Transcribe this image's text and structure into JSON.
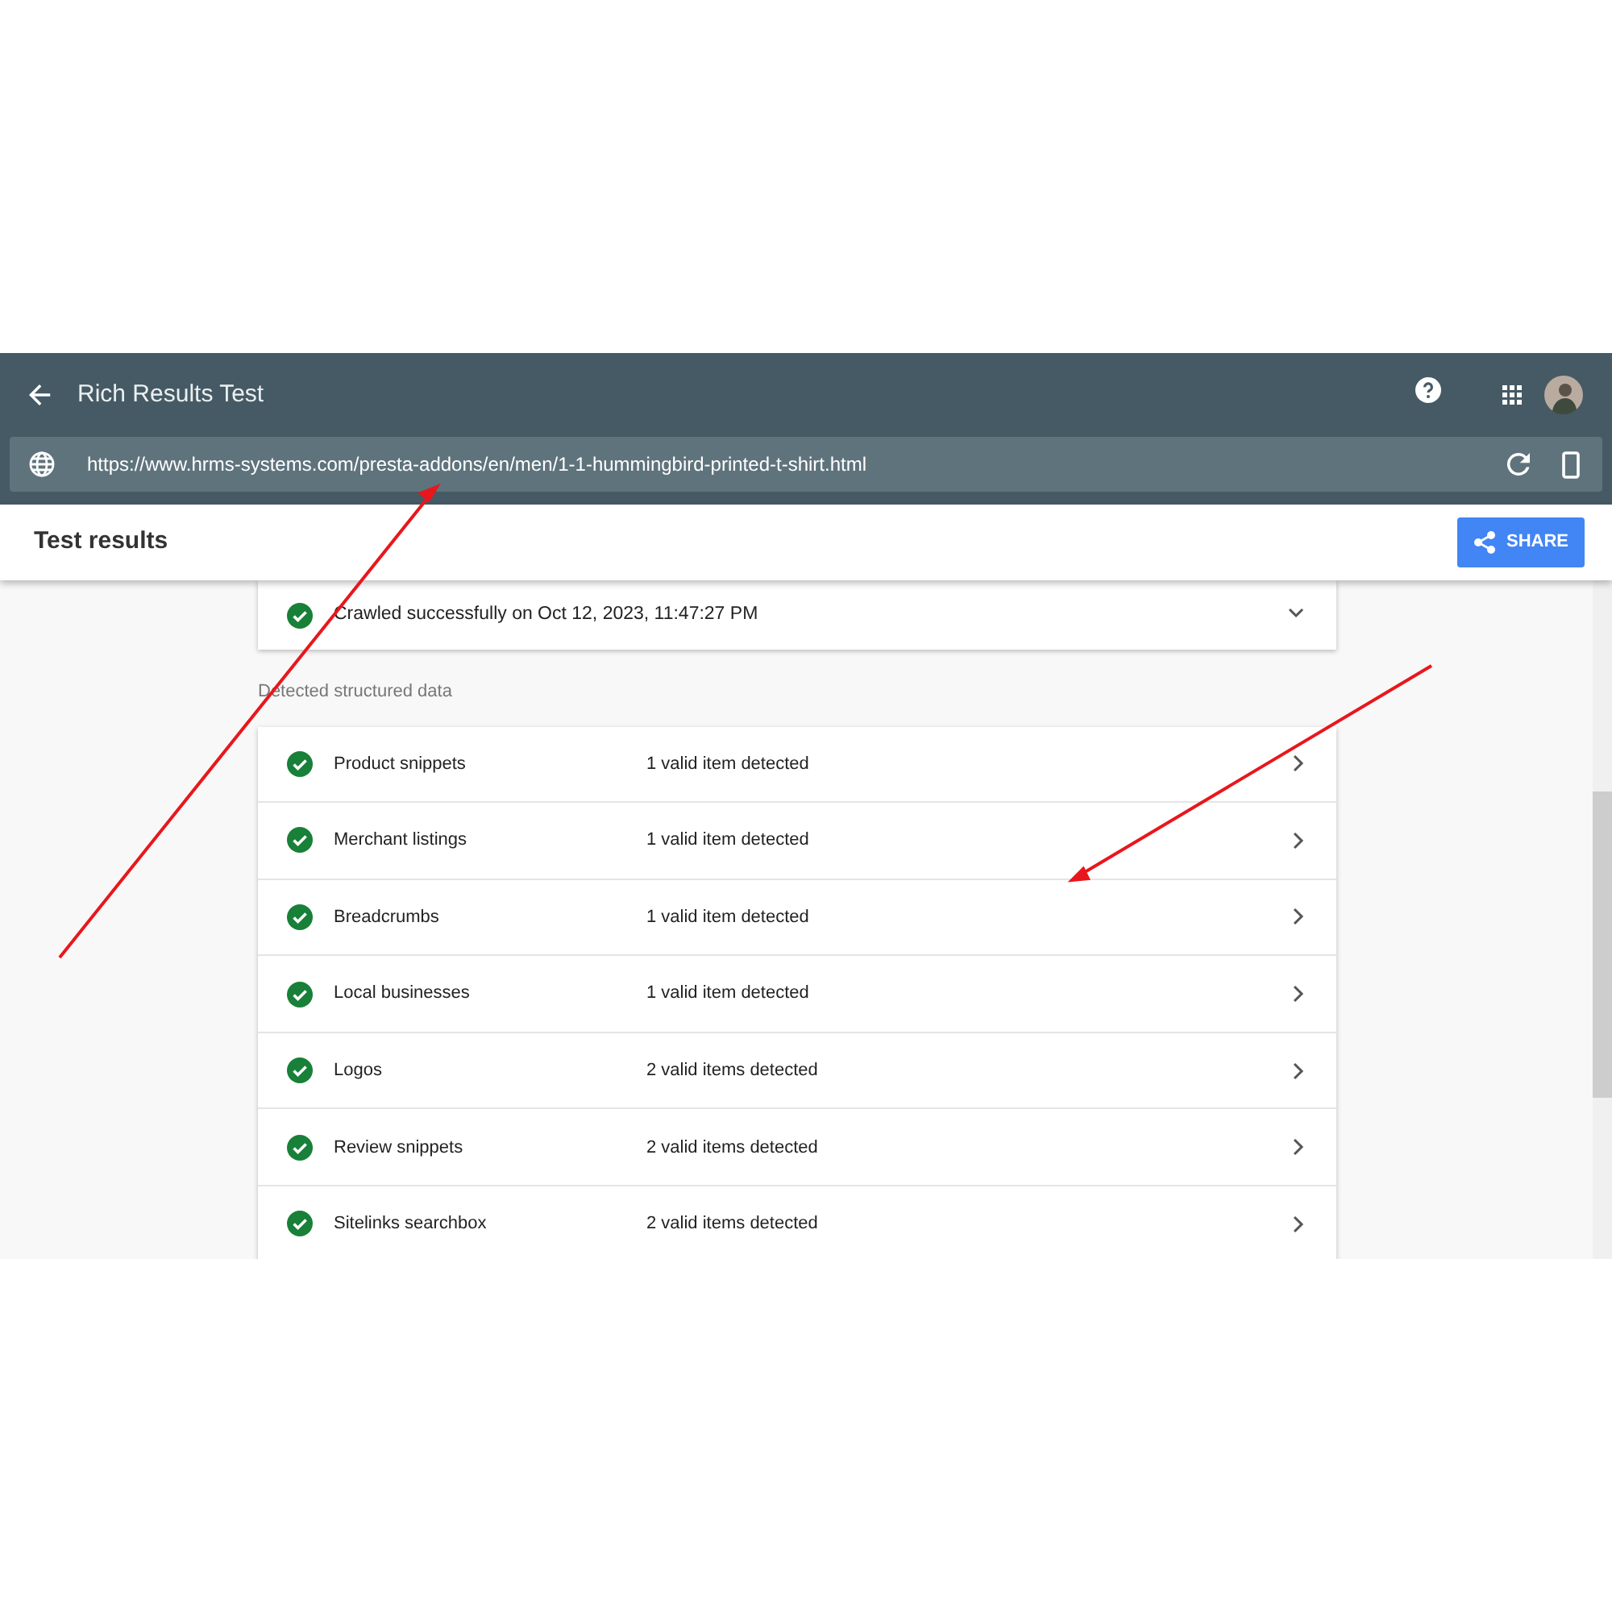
{
  "app_bar": {
    "title": "Rich Results Test"
  },
  "url_bar": {
    "url": "https://www.hrms-systems.com/presta-addons/en/men/1-1-hummingbird-printed-t-shirt.html"
  },
  "results_bar": {
    "title": "Test results",
    "share_button": "SHARE"
  },
  "crawl": {
    "text": "Crawled successfully on Oct 12, 2023, 11:47:27 PM",
    "expanded": false
  },
  "section_label": "Detected structured data",
  "items": [
    {
      "name": "Product snippets",
      "summary": "1 valid item detected"
    },
    {
      "name": "Merchant listings",
      "summary": "1 valid item detected"
    },
    {
      "name": "Breadcrumbs",
      "summary": "1 valid item detected"
    },
    {
      "name": "Local businesses",
      "summary": "1 valid item detected"
    },
    {
      "name": "Logos",
      "summary": "2 valid items detected"
    },
    {
      "name": "Review snippets",
      "summary": "2 valid items detected"
    },
    {
      "name": "Sitelinks searchbox",
      "summary": "2 valid items detected"
    }
  ]
}
